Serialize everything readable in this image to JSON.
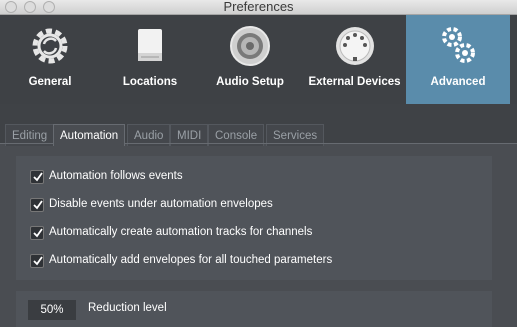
{
  "window": {
    "title": "Preferences"
  },
  "toolbar": {
    "items": [
      {
        "label": "General",
        "icon": "gear-icon"
      },
      {
        "label": "Locations",
        "icon": "drive-icon"
      },
      {
        "label": "Audio Setup",
        "icon": "speaker-icon"
      },
      {
        "label": "External Devices",
        "icon": "midi-port-icon"
      },
      {
        "label": "Advanced",
        "icon": "gears-icon"
      }
    ],
    "active": "Advanced",
    "active_color": "#5a8cab"
  },
  "tabs": {
    "items": [
      "Editing",
      "Automation",
      "Audio",
      "MIDI",
      "Console",
      "Services"
    ],
    "active": "Automation"
  },
  "options": [
    {
      "label": "Automation follows events",
      "checked": true
    },
    {
      "label": "Disable events under automation envelopes",
      "checked": true
    },
    {
      "label": "Automatically create automation tracks for channels",
      "checked": true
    },
    {
      "label": "Automatically add envelopes for all touched parameters",
      "checked": true
    }
  ],
  "reduction": {
    "value": "50%",
    "label": "Reduction level"
  }
}
